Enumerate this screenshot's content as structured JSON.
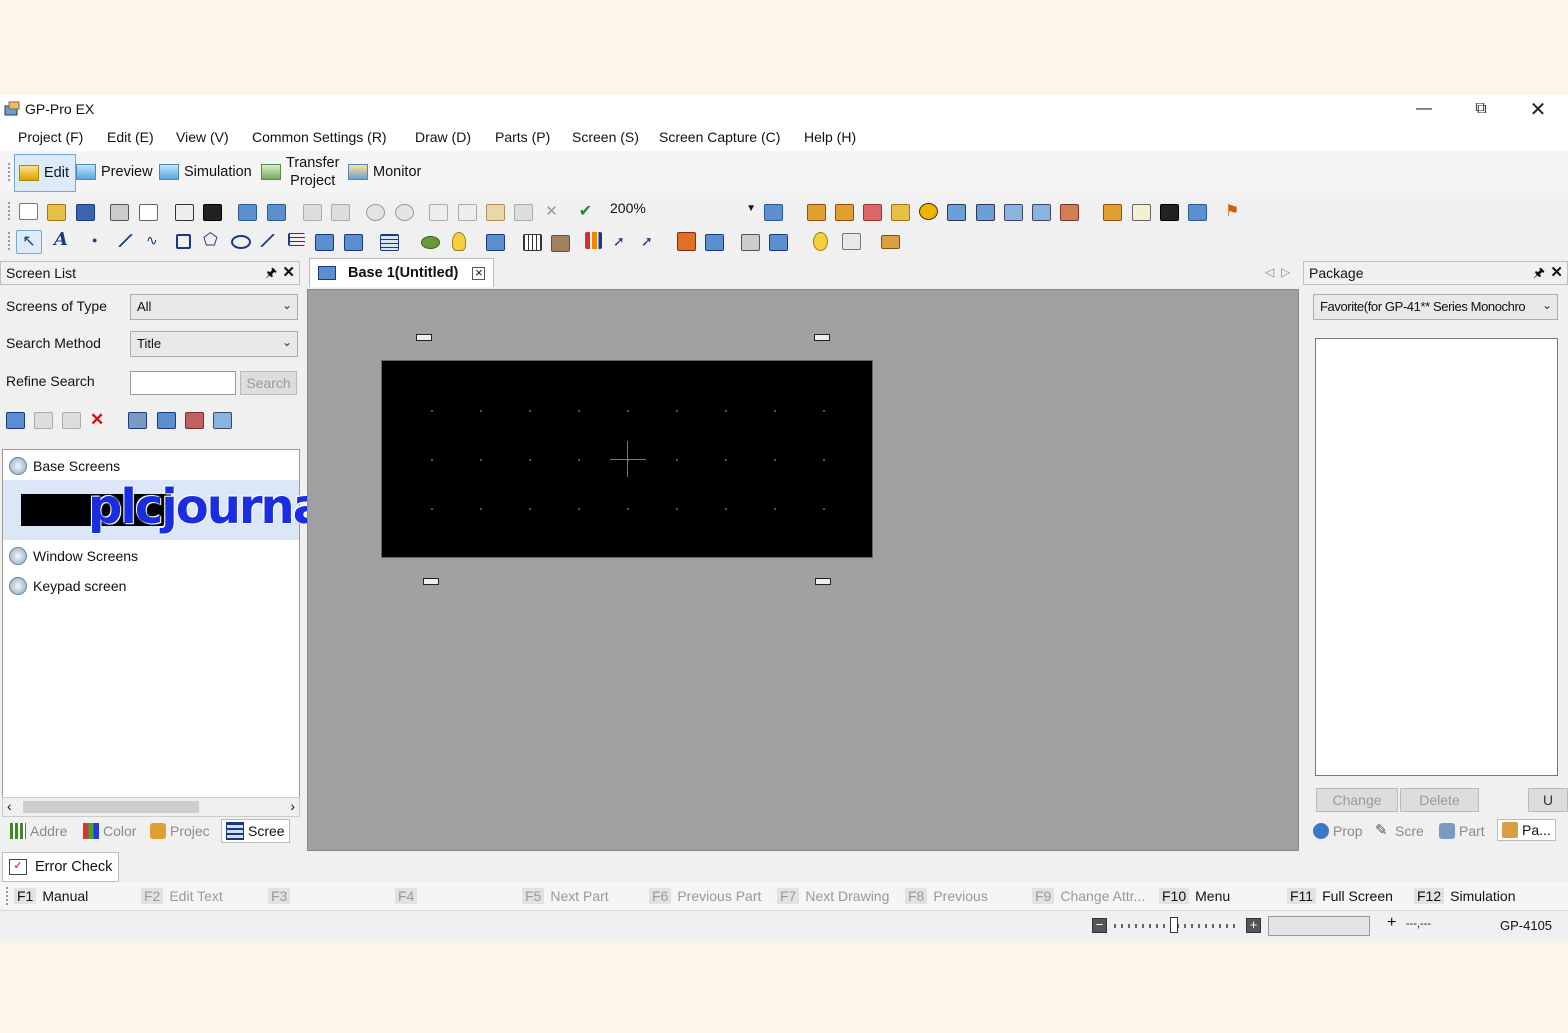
{
  "window": {
    "title": "GP-Pro EX"
  },
  "menu": [
    "Project (F)",
    "Edit (E)",
    "View (V)",
    "Common Settings (R)",
    "Draw (D)",
    "Parts (P)",
    "Screen (S)",
    "Screen Capture (C)",
    "Help (H)"
  ],
  "modes": {
    "edit": "Edit",
    "preview": "Preview",
    "simulation": "Simulation",
    "transfer_line1": "Transfer",
    "transfer_line2": "Project",
    "monitor": "Monitor"
  },
  "toolbar": {
    "zoom": "200%"
  },
  "screen_list": {
    "title": "Screen List",
    "screens_of_type_label": "Screens of Type",
    "screens_of_type_value": "All",
    "search_method_label": "Search Method",
    "search_method_value": "Title",
    "refine_search_label": "Refine Search",
    "refine_search_value": "",
    "search_button": "Search",
    "tree": {
      "base": "Base Screens",
      "window": "Window Screens",
      "keypad": "Keypad screen"
    },
    "watermark": "plcjournal.com"
  },
  "left_tabs": [
    "Addre",
    "Color",
    "Projec",
    "Scree"
  ],
  "document": {
    "tab": "Base 1(Untitled)"
  },
  "package": {
    "title": "Package",
    "combo_value": "Favorite(for GP-41** Series Monochro",
    "change": "Change",
    "delete": "Delete",
    "u": "U"
  },
  "right_tabs": [
    "Prop",
    "Scre",
    "Part",
    "Pa..."
  ],
  "error_check": "Error Check",
  "fkeys": [
    {
      "key": "F1",
      "label": "Manual",
      "enabled": true
    },
    {
      "key": "F2",
      "label": "Edit Text",
      "enabled": false
    },
    {
      "key": "F3",
      "label": "",
      "enabled": false
    },
    {
      "key": "F4",
      "label": "",
      "enabled": false
    },
    {
      "key": "F5",
      "label": "Next Part",
      "enabled": false
    },
    {
      "key": "F6",
      "label": "Previous Part",
      "enabled": false
    },
    {
      "key": "F7",
      "label": "Next Drawing",
      "enabled": false
    },
    {
      "key": "F8",
      "label": "Previous",
      "enabled": false
    },
    {
      "key": "F9",
      "label": "Change Attr...",
      "enabled": false
    },
    {
      "key": "F10",
      "label": "Menu",
      "enabled": true
    },
    {
      "key": "F11",
      "label": "Full Screen",
      "enabled": true
    },
    {
      "key": "F12",
      "label": "Simulation",
      "enabled": true
    }
  ],
  "status": {
    "coords": "---,---",
    "model": "GP-4105"
  }
}
